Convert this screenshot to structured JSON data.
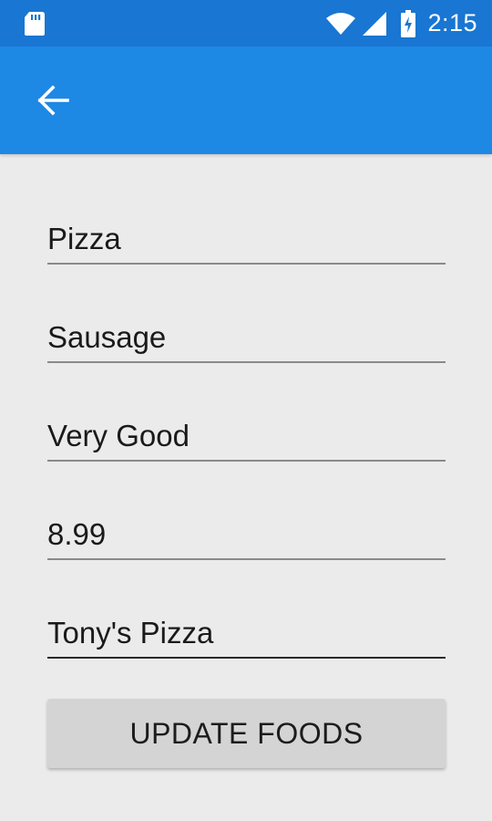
{
  "status_bar": {
    "time": "2:15",
    "icons": [
      "sd-card-icon",
      "wifi-icon",
      "signal-icon",
      "battery-charging-icon"
    ]
  },
  "app_bar": {
    "back_icon": "arrow-back-icon",
    "color": "#1e88e5",
    "status_color": "#1976d2"
  },
  "form": {
    "fields": [
      {
        "value": "Pizza"
      },
      {
        "value": "Sausage"
      },
      {
        "value": "Very Good"
      },
      {
        "value": "8.99"
      },
      {
        "value": "Tony's Pizza"
      }
    ],
    "update_button_label": "UPDATE FOODS"
  }
}
